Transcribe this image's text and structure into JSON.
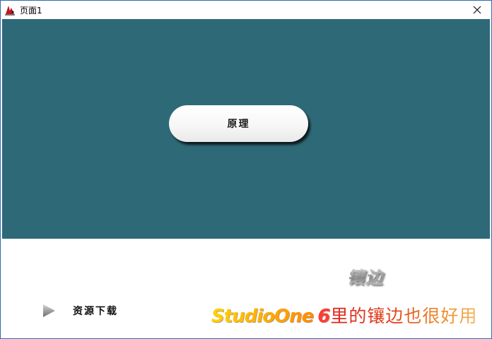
{
  "window": {
    "title": "页面1",
    "icon": "app-logo-icon",
    "close_icon": "close-icon"
  },
  "stage": {
    "background_color": "#2e6977",
    "button_label": "原理"
  },
  "bottom": {
    "download_label": "资源下载",
    "download_icon": "play-arrow-icon",
    "bezel_title": "镶边",
    "banner": {
      "brand": "StudioOne",
      "version": "6",
      "text": "里的镶边也很好用"
    }
  },
  "colors": {
    "teal": "#2e6977",
    "border": "#2b6cb0",
    "banner_yellow": "#ffd400",
    "banner_red": "#e0201a"
  }
}
